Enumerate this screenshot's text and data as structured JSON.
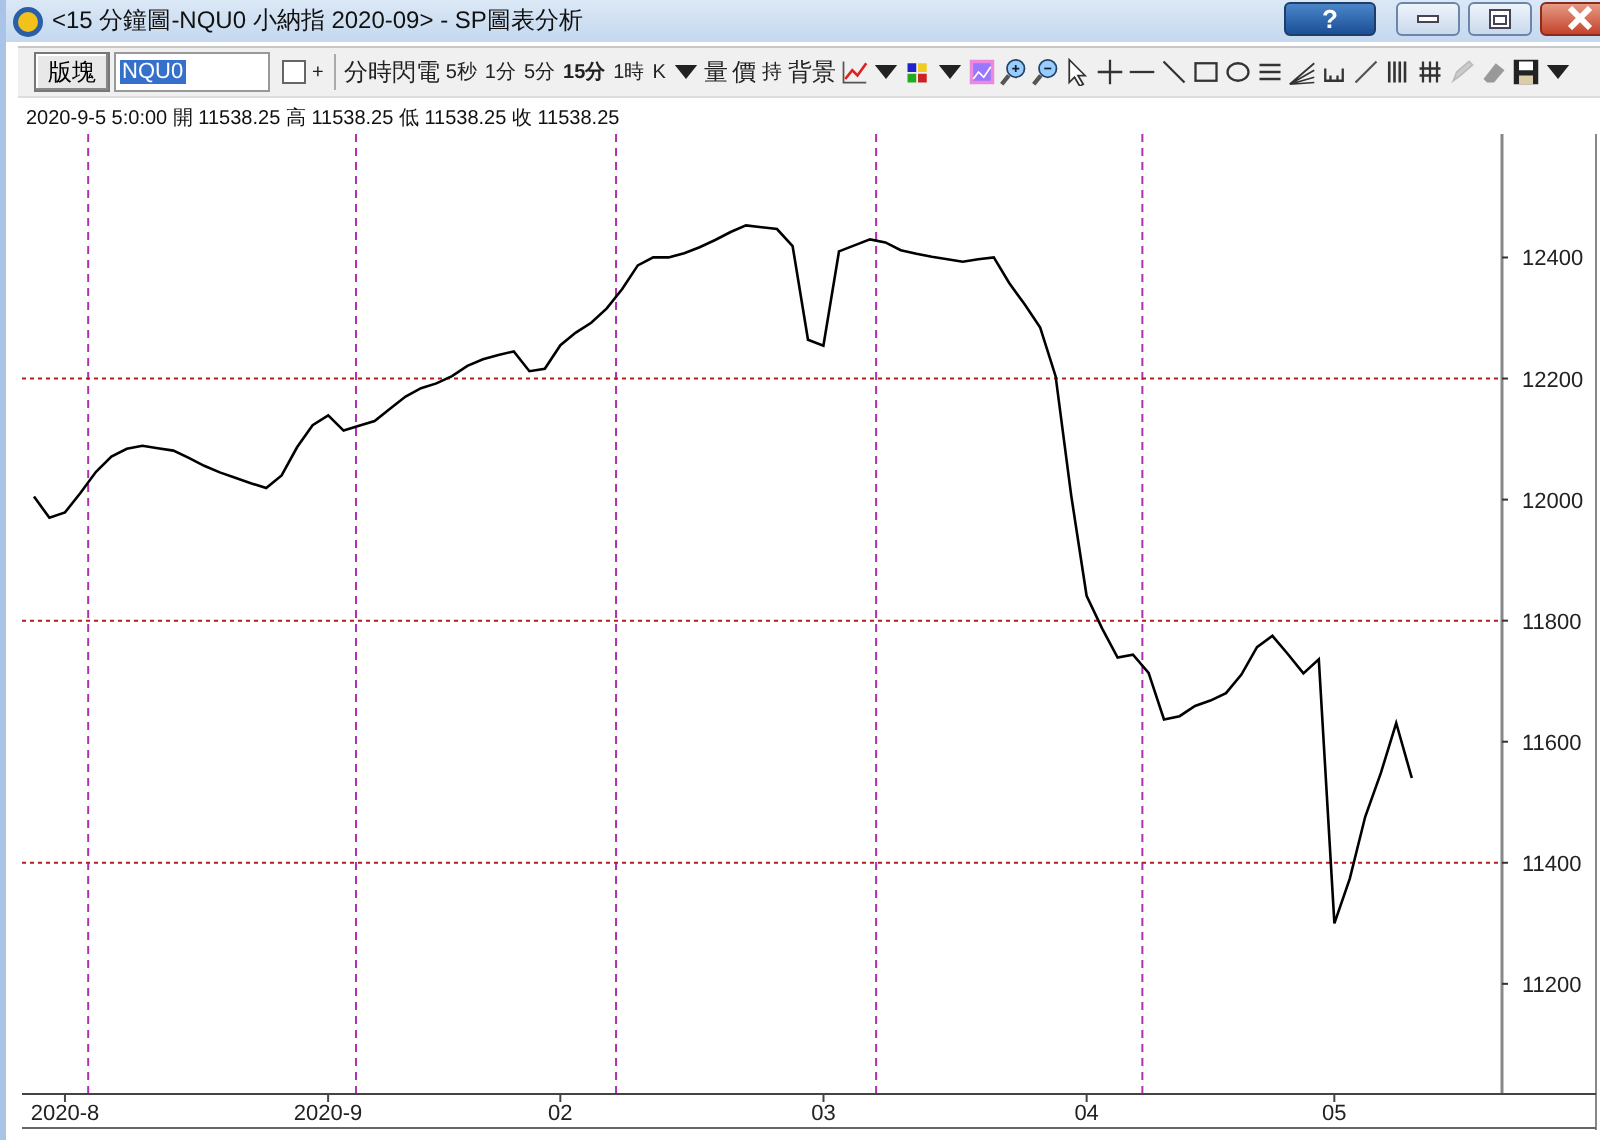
{
  "window": {
    "title": "<15 分鐘圖-NQU0 小納指 2020-09> - SP圖表分析",
    "help": "?"
  },
  "toolbar": {
    "layout_button": "版塊",
    "symbol_field": "NQU0",
    "checkbox": {
      "checked": false
    },
    "plus": "+",
    "intervals": [
      {
        "label": "分時閃電",
        "selected": false
      },
      {
        "label": "5秒",
        "selected": false
      },
      {
        "label": "1分",
        "selected": false
      },
      {
        "label": "5分",
        "selected": false
      },
      {
        "label": "15分",
        "selected": true
      },
      {
        "label": "1時",
        "selected": false
      },
      {
        "label": "K",
        "selected": false
      }
    ],
    "volume": "量",
    "price": "價",
    "hold": "持",
    "background": "背景"
  },
  "quote_line": "2020-9-5 5:0:00 開 11538.25 高 11538.25 低 11538.25 收 11538.25",
  "chart": {
    "chart_data": {
      "type": "line",
      "grid": true,
      "ylim": [
        11018,
        12604
      ],
      "categories": [
        null,
        null,
        "2020-8",
        null,
        null,
        null,
        null,
        null,
        null,
        null,
        null,
        null,
        null,
        null,
        null,
        null,
        null,
        null,
        null,
        "2020-9",
        null,
        null,
        null,
        null,
        null,
        null,
        null,
        null,
        null,
        null,
        null,
        null,
        null,
        null,
        "02",
        null,
        null,
        null,
        null,
        null,
        null,
        null,
        null,
        null,
        null,
        null,
        null,
        null,
        null,
        null,
        null,
        "03",
        null,
        null,
        null,
        null,
        null,
        null,
        null,
        null,
        null,
        null,
        null,
        null,
        null,
        null,
        null,
        null,
        "04",
        null,
        null,
        null,
        null,
        null,
        null,
        null,
        null,
        null,
        null,
        null,
        null,
        null,
        null,
        null,
        "05",
        null,
        null,
        null,
        null,
        null
      ],
      "yticks": [
        11200,
        11400,
        11600,
        11800,
        12000,
        12200,
        12400
      ],
      "series": [
        {
          "color": "#000000",
          "values": [
            12005,
            11970,
            11979,
            12011,
            12046,
            12071,
            12084,
            12089,
            12085,
            12081,
            12069,
            12056,
            12045,
            12036,
            12027,
            12019,
            12040,
            12087,
            12123,
            12139,
            12114,
            12122,
            12130,
            12150,
            12170,
            12184,
            12192,
            12204,
            12221,
            12232,
            12239,
            12245,
            12212,
            12216,
            12255,
            12276,
            12292,
            12316,
            12348,
            12387,
            12400,
            12400,
            12407,
            12417,
            12429,
            12442,
            12453,
            12450,
            12447,
            12419,
            12264,
            12254,
            12410,
            12420,
            12430,
            12425,
            12412,
            12406,
            12401,
            12397,
            12393,
            12397,
            12400,
            12358,
            12322,
            12284,
            12204,
            12007,
            11841,
            11787,
            11739,
            11744,
            11714,
            11637,
            11642,
            11659,
            11668,
            11680,
            11711,
            11756,
            11775,
            11745,
            11713,
            11736,
            11300,
            11374,
            11476,
            11548,
            11631,
            11540
          ]
        }
      ]
    }
  }
}
